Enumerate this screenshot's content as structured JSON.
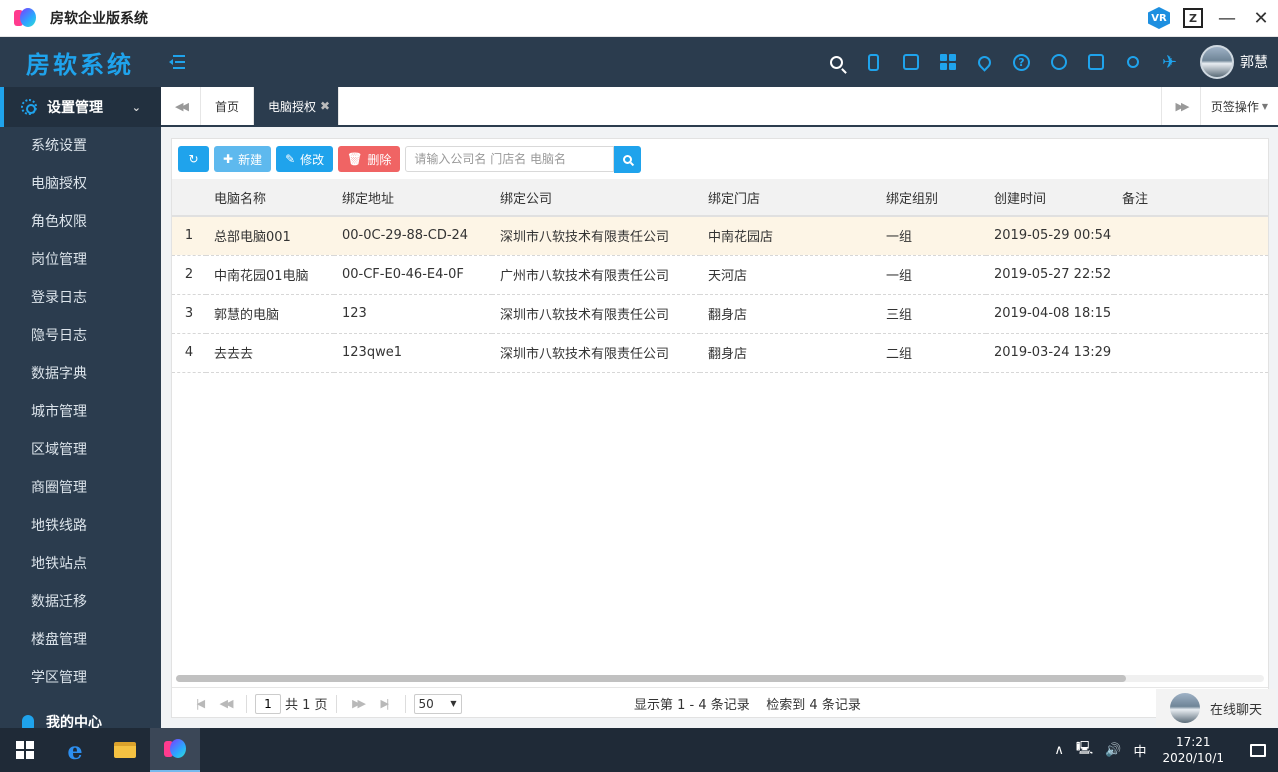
{
  "window": {
    "title": "房软企业版系统",
    "vr_label": "VR",
    "buttons": {
      "minimize": "—",
      "close": "✕"
    }
  },
  "header": {
    "brand": "房软系统",
    "user_name": "郭慧"
  },
  "sidebar": {
    "group_label": "设置管理",
    "items": [
      "系统设置",
      "电脑授权",
      "角色权限",
      "岗位管理",
      "登录日志",
      "隐号日志",
      "数据字典",
      "城市管理",
      "区域管理",
      "商圈管理",
      "地铁线路",
      "地铁站点",
      "数据迁移",
      "楼盘管理",
      "学区管理"
    ],
    "footer_label": "我的中心"
  },
  "tabs": {
    "items": [
      "首页",
      "电脑授权"
    ],
    "close_glyph": "✖",
    "ops_label": "页签操作"
  },
  "toolbar": {
    "new_label": "新建",
    "edit_label": "修改",
    "delete_label": "删除",
    "search_placeholder": "请输入公司名 门店名 电脑名"
  },
  "table": {
    "columns": [
      "",
      "电脑名称",
      "绑定地址",
      "绑定公司",
      "绑定门店",
      "绑定组别",
      "创建时间",
      "备注"
    ],
    "rows": [
      {
        "no": "1",
        "name": "总部电脑001",
        "address": "00-0C-29-88-CD-24",
        "company": "深圳市八软技术有限责任公司",
        "store": "中南花园店",
        "group": "一组",
        "created": "2019-05-29 00:54",
        "note": ""
      },
      {
        "no": "2",
        "name": "中南花园01电脑",
        "address": "00-CF-E0-46-E4-0F",
        "company": "广州市八软技术有限责任公司",
        "store": "天河店",
        "group": "一组",
        "created": "2019-05-27 22:52",
        "note": ""
      },
      {
        "no": "3",
        "name": "郭慧的电脑",
        "address": "123",
        "company": "深圳市八软技术有限责任公司",
        "store": "翻身店",
        "group": "三组",
        "created": "2019-04-08 18:15",
        "note": ""
      },
      {
        "no": "4",
        "name": "去去去",
        "address": "123qwe1",
        "company": "深圳市八软技术有限责任公司",
        "store": "翻身店",
        "group": "二组",
        "created": "2019-03-24 13:29",
        "note": ""
      }
    ]
  },
  "pager": {
    "page": "1",
    "total_pages_text": "共 1 页",
    "page_size": "50",
    "info": "显示第 1 - 4 条记录    检索到 4 条记录"
  },
  "chat": {
    "label": "在线聊天"
  },
  "taskbar": {
    "time": "17:21",
    "date": "2020/10/1",
    "ime": "中"
  }
}
